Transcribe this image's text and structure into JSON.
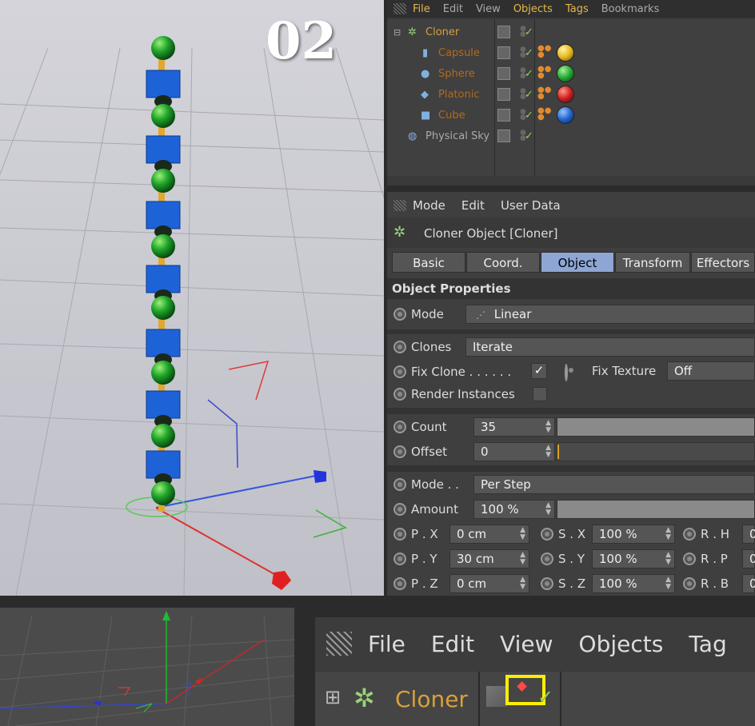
{
  "overlay": {
    "step_number": "02"
  },
  "object_manager": {
    "menu": [
      "File",
      "Edit",
      "View",
      "Objects",
      "Tags",
      "Bookmarks"
    ],
    "objects": [
      {
        "name": "Cloner",
        "color": "#d9a038",
        "ball": null
      },
      {
        "name": "Capsule",
        "color": "#c07a20",
        "ball": "#e6b820"
      },
      {
        "name": "Sphere",
        "color": "#c07a20",
        "ball": "#22aa33"
      },
      {
        "name": "Platonic",
        "color": "#c07a20",
        "ball": "#cc2020"
      },
      {
        "name": "Cube",
        "color": "#c07a20",
        "ball": "#2266cc"
      },
      {
        "name": "Physical Sky",
        "color": "#aaaaaa",
        "ball": null
      }
    ]
  },
  "attribute_manager": {
    "menu": [
      "Mode",
      "Edit",
      "User Data"
    ],
    "title": "Cloner Object [Cloner]",
    "tabs": [
      "Basic",
      "Coord.",
      "Object",
      "Transform",
      "Effectors"
    ],
    "active_tab": "Object",
    "section_title": "Object Properties",
    "mode": {
      "label": "Mode",
      "value": "Linear"
    },
    "clones": {
      "label": "Clones",
      "value": "Iterate"
    },
    "fix_clone": {
      "label": "Fix Clone . . . . . .",
      "checked": true
    },
    "fix_texture": {
      "label": "Fix Texture",
      "value": "Off"
    },
    "render_instances": {
      "label": "Render Instances",
      "checked": false
    },
    "count": {
      "label": "Count",
      "value": "35"
    },
    "offset": {
      "label": "Offset",
      "value": "0"
    },
    "step_mode": {
      "label": "Mode . .",
      "value": "Per Step"
    },
    "amount": {
      "label": "Amount",
      "value": "100 %"
    },
    "transform_rows": [
      {
        "p_label": "P . X",
        "p_value": "0 cm",
        "s_label": "S . X",
        "s_value": "100 %",
        "r_label": "R . H",
        "r_value": "0"
      },
      {
        "p_label": "P . Y",
        "p_value": "30 cm",
        "s_label": "S . Y",
        "s_value": "100 %",
        "r_label": "R . P",
        "r_value": "0"
      },
      {
        "p_label": "P . Z",
        "p_value": "0 cm",
        "s_label": "S . Z",
        "s_value": "100 %",
        "r_label": "R . B",
        "r_value": "0"
      }
    ]
  },
  "zoomed_object_manager": {
    "menu": [
      "File",
      "Edit",
      "View",
      "Objects",
      "Tag"
    ],
    "object_name": "Cloner",
    "highlight_color": "#ffee00"
  },
  "colors": {
    "accent_tab": "#8ea6d3",
    "object_name": "#d9a038",
    "check": "#8fd05f"
  }
}
